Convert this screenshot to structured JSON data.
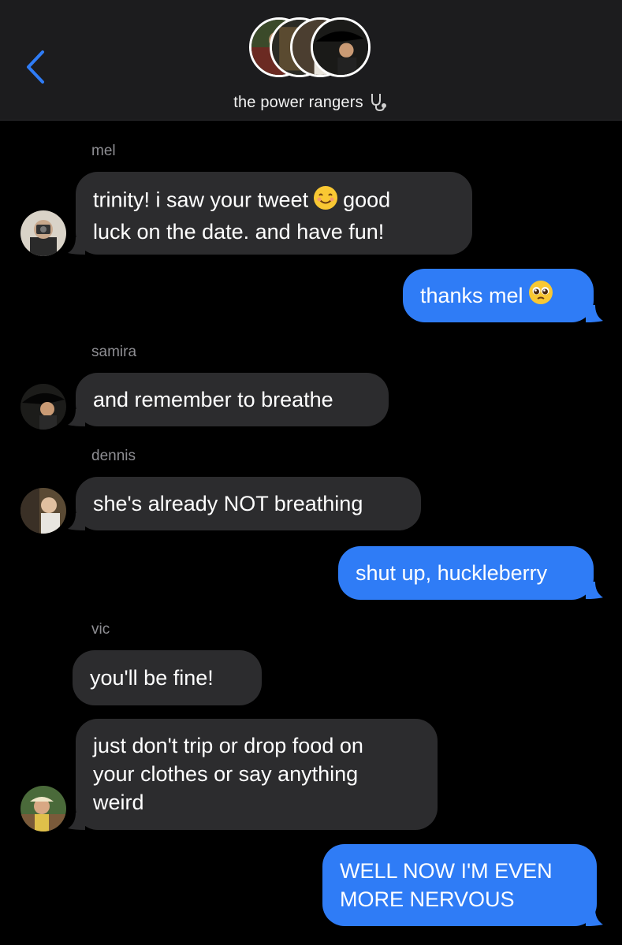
{
  "header": {
    "group_name": "the power rangers",
    "title_emoji": "stethoscope-icon"
  },
  "colors": {
    "incoming_bubble": "#2c2c2e",
    "outgoing_bubble": "#2f7cf6",
    "accent": "#2f7cf6",
    "sender_label": "#8e8e93"
  },
  "messages": [
    {
      "sender": "mel",
      "direction": "in",
      "text_a": "trinity! i saw your tweet",
      "emoji": "smiling-face-icon",
      "text_b": "good",
      "text_c": "luck on the date. and have fun!"
    },
    {
      "direction": "out",
      "text": "thanks mel",
      "emoji": "pleading-face-icon"
    },
    {
      "sender": "samira",
      "direction": "in",
      "text": "and remember to breathe"
    },
    {
      "sender": "dennis",
      "direction": "in",
      "text": "she's already NOT breathing"
    },
    {
      "direction": "out",
      "text": "shut up, huckleberry"
    },
    {
      "sender": "vic",
      "direction": "in",
      "text": "you'll be fine!"
    },
    {
      "sender": "vic",
      "direction": "in",
      "text_line1": "just don't trip or drop food on",
      "text_line2": "your clothes or say anything",
      "text_line3": "weird"
    },
    {
      "direction": "out",
      "text_line1": "WELL NOW I'M EVEN",
      "text_line2": "MORE NERVOUS"
    }
  ]
}
